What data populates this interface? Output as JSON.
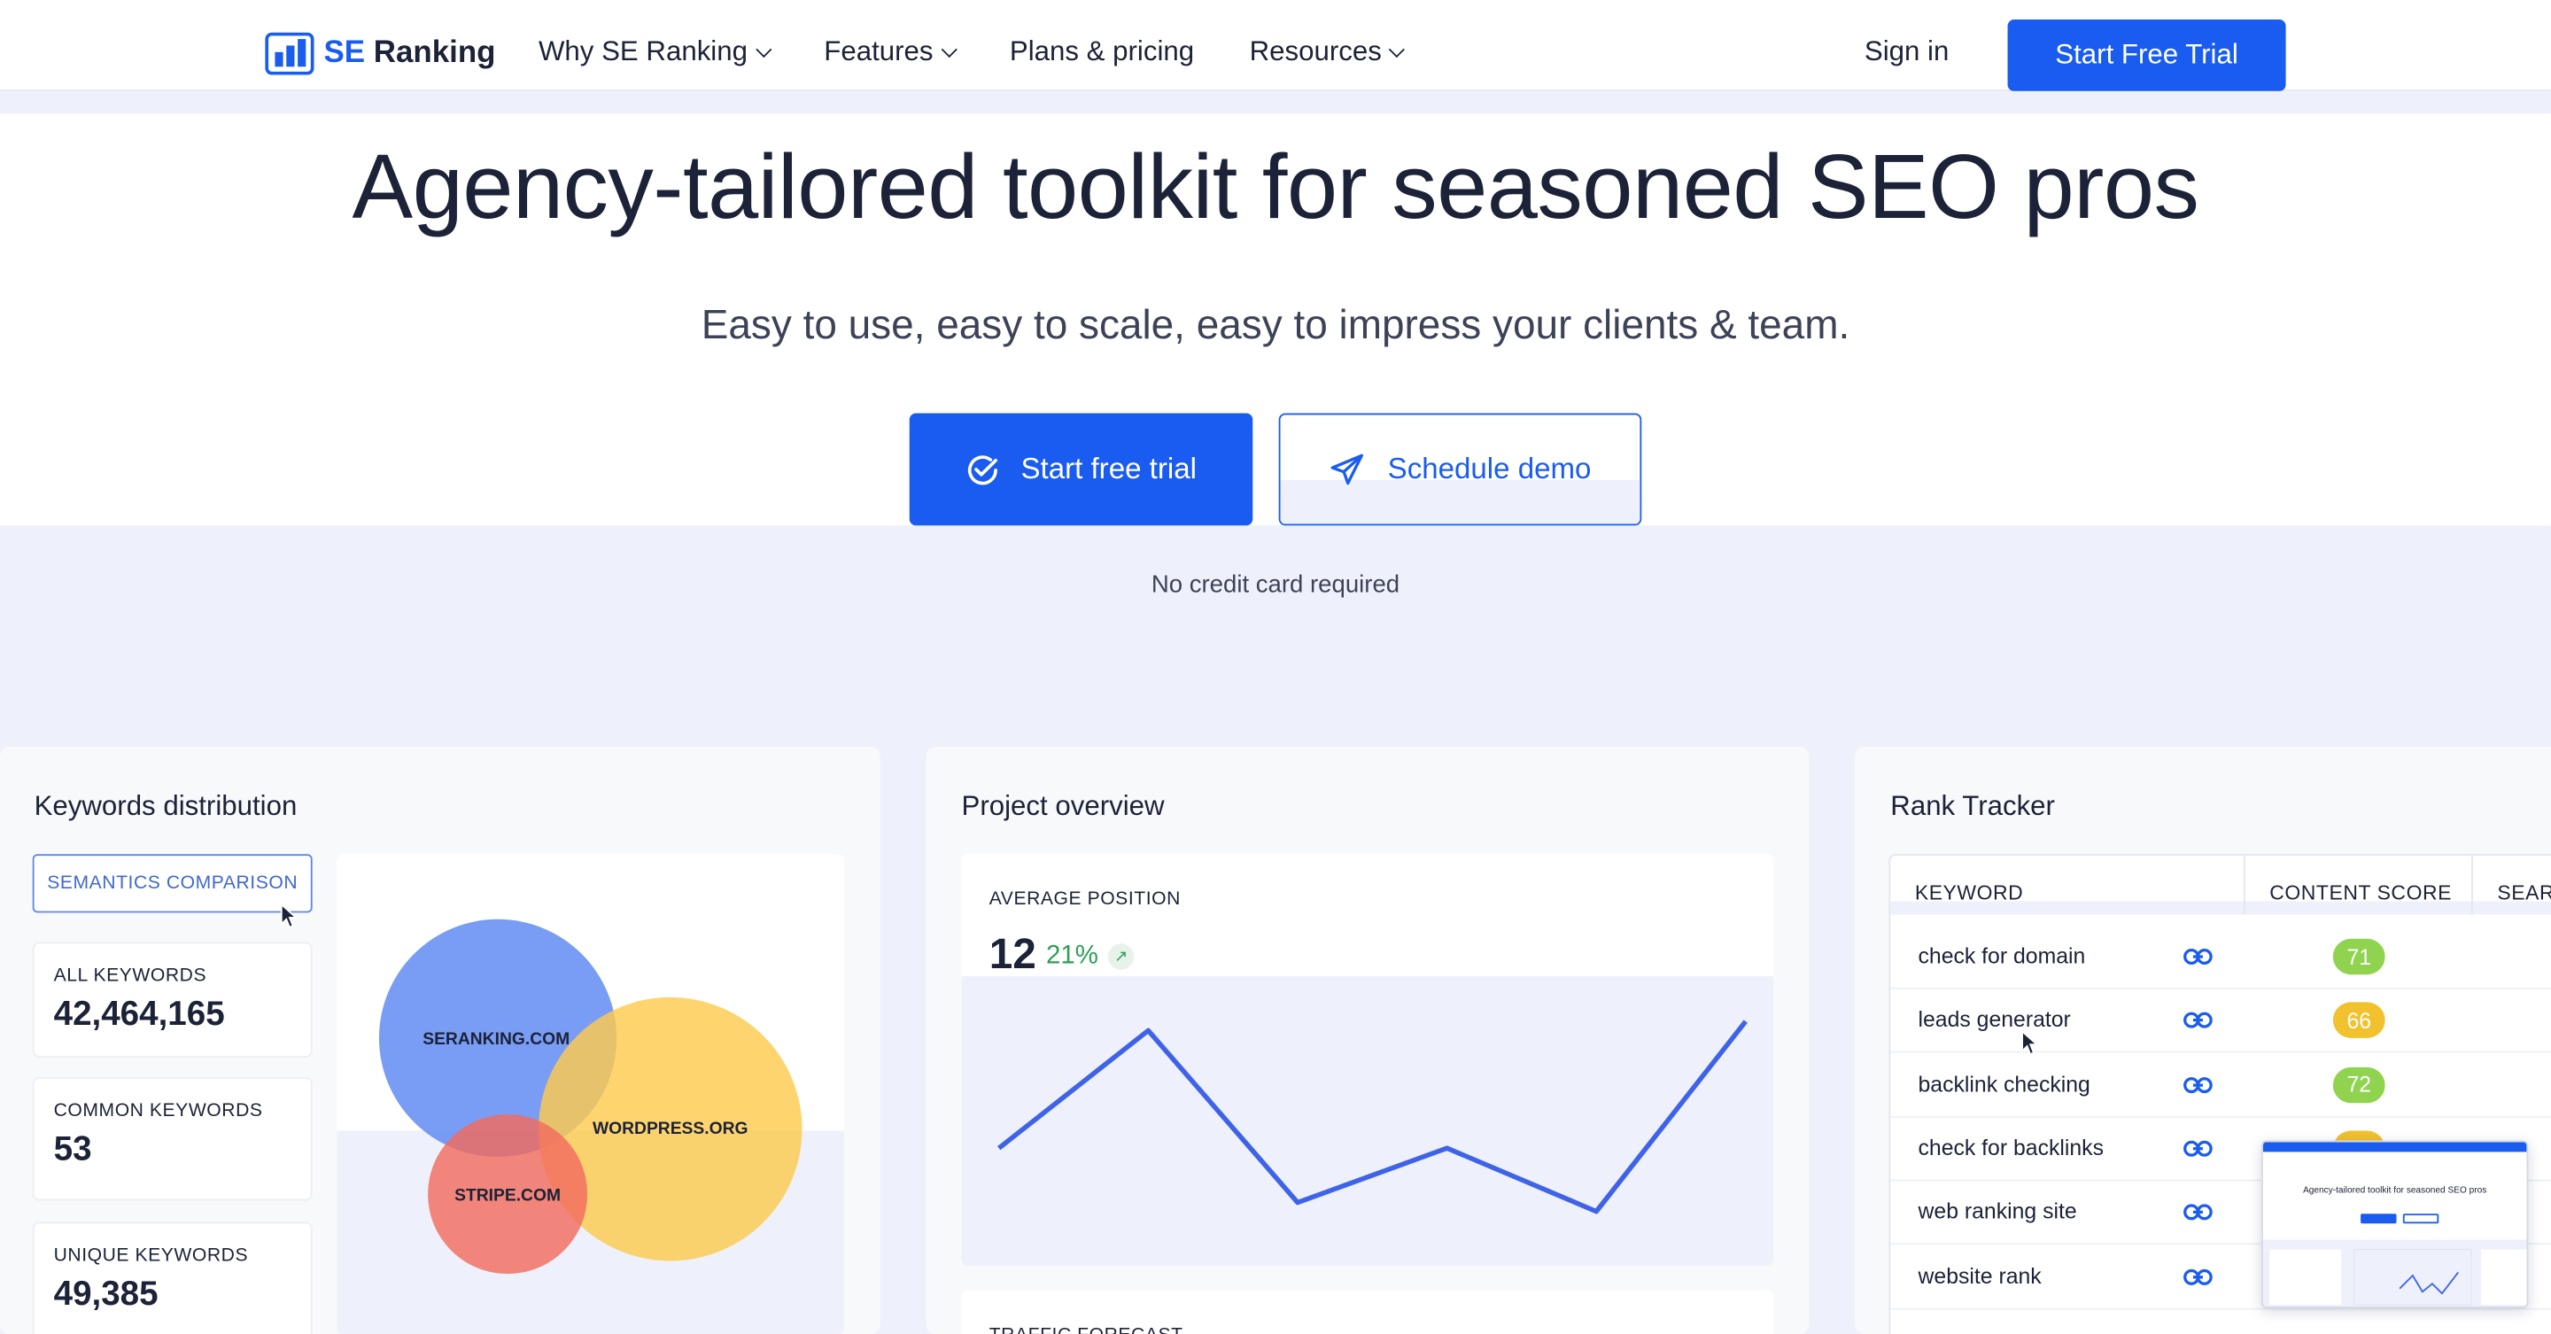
{
  "nav": {
    "logo_se": "SE",
    "logo_ranking": "Ranking",
    "menu": [
      "Why SE Ranking",
      "Features",
      "Plans & pricing",
      "Resources"
    ],
    "sign_in": "Sign in",
    "cta": "Start Free Trial"
  },
  "hero": {
    "title": "Agency-tailored toolkit for seasoned SEO pros",
    "subtitle": "Easy to use, easy to scale, easy to impress your clients & team.",
    "primary_cta": "Start free trial",
    "secondary_cta": "Schedule demo",
    "note": "No credit card required"
  },
  "keywords_card": {
    "title": "Keywords distribution",
    "button": "SEMANTICS COMPARISON",
    "stats": [
      {
        "label": "ALL KEYWORDS",
        "value": "42,464,165"
      },
      {
        "label": "COMMON KEYWORDS",
        "value": "53"
      },
      {
        "label": "UNIQUE KEYWORDS",
        "value": "49,385"
      }
    ],
    "venn": [
      {
        "label": "SERANKING.COM",
        "color": "#5c88f2"
      },
      {
        "label": "WORDPRESS.ORG",
        "color": "#fccb4d"
      },
      {
        "label": "STRIPE.COM",
        "color": "#f26b5e"
      }
    ]
  },
  "project_card": {
    "title": "Project overview",
    "avg_label": "AVERAGE POSITION",
    "avg_value": "12",
    "avg_change": "21%",
    "line_color": "#3f63e8",
    "next_section_label": "TRAFFIC FORECAST"
  },
  "chart_data": {
    "type": "line",
    "title": "",
    "xlabel": "",
    "ylabel": "",
    "x": [
      1,
      2,
      3,
      4,
      5,
      6
    ],
    "values": [
      5,
      18,
      -1,
      5,
      -2,
      19
    ],
    "ylim": [
      -8,
      24
    ],
    "grid": false
  },
  "rank_card": {
    "title": "Rank Tracker",
    "columns": [
      "KEYWORD",
      "CONTENT SCORE",
      "SEAR"
    ],
    "rows": [
      {
        "keyword": "check for domain",
        "score": "71",
        "color": "#8fd34f"
      },
      {
        "keyword": "leads generator",
        "score": "66",
        "color": "#f2c12e"
      },
      {
        "keyword": "backlink checking",
        "score": "72",
        "color": "#8fd34f"
      },
      {
        "keyword": "check for backlinks",
        "score": "",
        "color": "#f2c12e"
      },
      {
        "keyword": "web ranking site",
        "score": "",
        "color": "#f2c12e"
      },
      {
        "keyword": "website rank",
        "score": "",
        "color": "#8fd34f"
      }
    ],
    "thumbnail_title": "Agency-tailored toolkit for seasoned SEO pros"
  },
  "colors": {
    "brand_blue": "#1a5cf0",
    "band_bg": "#eef1fb",
    "positive_green": "#2e9e57"
  }
}
